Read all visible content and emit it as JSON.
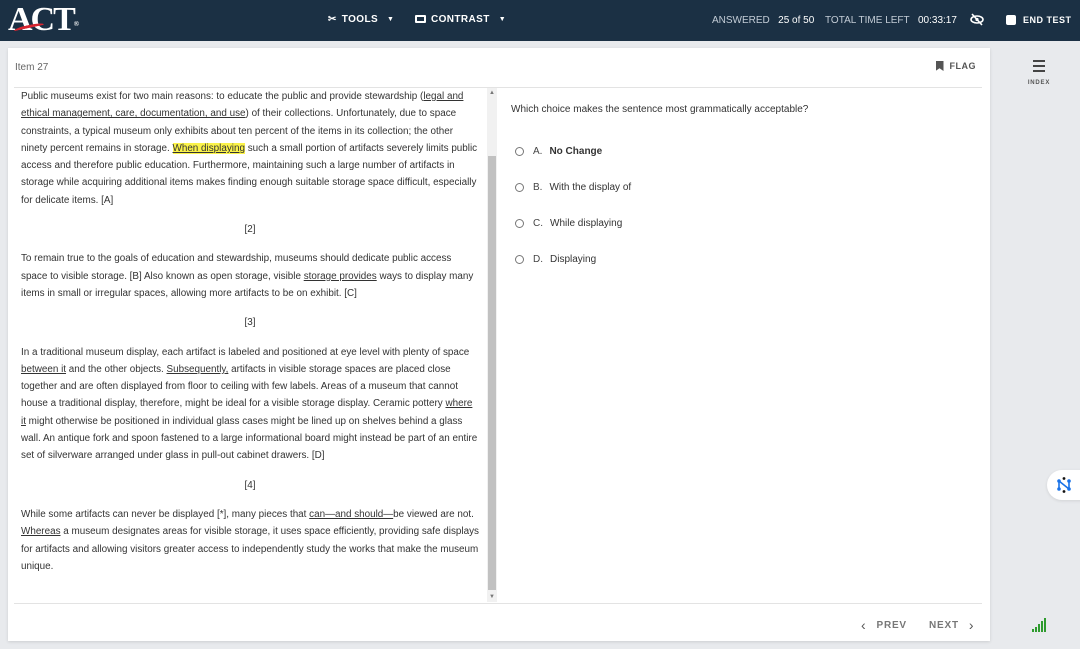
{
  "header": {
    "logo": "ACT",
    "tools_label": "TOOLS",
    "contrast_label": "CONTRAST",
    "answered_label": "ANSWERED",
    "answered_value": "25 of 50",
    "time_label": "TOTAL TIME LEFT",
    "time_value": "00:33:17",
    "hide_icon": "eye-slash-icon",
    "end_test_label": "END TEST"
  },
  "item": {
    "label": "Item 27",
    "flag_label": "FLAG"
  },
  "passage": [
    {
      "type": "p",
      "segments": [
        {
          "t": "Public museums exist for two main reasons: to educate the public and provide stewardship ("
        },
        {
          "t": "legal and ethical management, care, documentation, and use",
          "s": "u"
        },
        {
          "t": ") of their collections. Unfortunately, due to space constraints, a typical museum only exhibits about ten percent of the items in its collection; the other ninety percent remains in storage. "
        },
        {
          "t": "When displaying",
          "s": "hl"
        },
        {
          "t": " such a small portion of artifacts severely limits public access and therefore public education. Furthermore, maintaining such a large number of artifacts in storage while acquiring additional items makes finding enough suitable storage space difficult, especially for delicate items. [A]"
        }
      ]
    },
    {
      "type": "num",
      "segments": [
        {
          "t": "[2]"
        }
      ]
    },
    {
      "type": "p",
      "segments": [
        {
          "t": "To remain true to the goals of education and stewardship, museums should dedicate public access space to visible storage. [B] Also known as open storage, visible "
        },
        {
          "t": "storage provides",
          "s": "u"
        },
        {
          "t": " ways to display many items in small or irregular spaces, allowing more artifacts to be on exhibit. [C]"
        }
      ]
    },
    {
      "type": "num",
      "segments": [
        {
          "t": "[3]"
        }
      ]
    },
    {
      "type": "p",
      "segments": [
        {
          "t": "In a traditional museum display, each artifact is labeled and positioned at eye level with plenty of space "
        },
        {
          "t": "between it",
          "s": "u"
        },
        {
          "t": " and the other objects. "
        },
        {
          "t": "Subsequently,",
          "s": "u"
        },
        {
          "t": " artifacts in visible storage spaces are placed close together and are often displayed from floor to ceiling with few labels. Areas of a museum that cannot house a traditional display, therefore, might be ideal for a visible storage display. Ceramic pottery "
        },
        {
          "t": "where it",
          "s": "u"
        },
        {
          "t": " might otherwise be positioned in individual glass cases might be lined up on shelves behind a glass wall. An antique fork and spoon fastened to a large informational board might instead be part of an entire set of silverware arranged under glass in pull-out cabinet drawers. [D]"
        }
      ]
    },
    {
      "type": "num",
      "segments": [
        {
          "t": "[4]"
        }
      ]
    },
    {
      "type": "p",
      "segments": [
        {
          "t": "While some artifacts can never be displayed [*], many pieces that "
        },
        {
          "t": "can—and should—",
          "s": "u"
        },
        {
          "t": "be viewed are not. "
        },
        {
          "t": "Whereas",
          "s": "u"
        },
        {
          "t": " a museum designates areas for visible storage, it uses space efficiently, providing safe displays for artifacts and allowing visitors greater access to independently study the works that make the museum unique."
        }
      ]
    }
  ],
  "question": {
    "prompt": "Which choice makes the sentence most grammatically acceptable?",
    "options": [
      {
        "letter": "A.",
        "text": "No Change"
      },
      {
        "letter": "B.",
        "text": "With the display of"
      },
      {
        "letter": "C.",
        "text": "While displaying"
      },
      {
        "letter": "D.",
        "text": "Displaying"
      }
    ]
  },
  "nav": {
    "prev_label": "PREV",
    "next_label": "NEXT"
  },
  "sidebar": {
    "index_label": "INDEX"
  },
  "colors": {
    "header_bg": "#1b3044",
    "highlight": "#fbf34a",
    "signal": "#2e9b2e",
    "widget": "#1a73e8"
  }
}
